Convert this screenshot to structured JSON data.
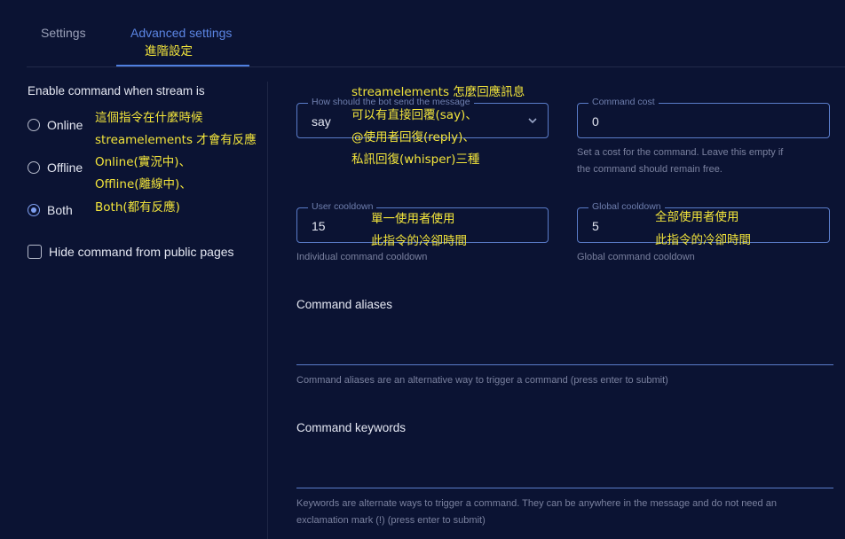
{
  "tabs": [
    {
      "label": "Settings"
    },
    {
      "label": "Advanced settings"
    }
  ],
  "annotations": {
    "tab": "進階設定",
    "radio": [
      "這個指令在什麼時候",
      "streamelements 才會有反應",
      "Online(實況中)、",
      "Offline(離線中)、",
      "Both(都有反應)"
    ],
    "send": [
      "streamelements 怎麼回應訊息",
      "可以有直接回覆(say)、",
      "@使用者回復(reply)、",
      "私訊回復(whisper)三種"
    ],
    "user_cd": [
      "單一使用者使用",
      "此指令的冷卻時間"
    ],
    "global_cd": [
      "全部使用者使用",
      "此指令的冷卻時間"
    ]
  },
  "left": {
    "section_label": "Enable command when stream is",
    "radios": [
      {
        "label": "Online",
        "checked": false
      },
      {
        "label": "Offline",
        "checked": false
      },
      {
        "label": "Both",
        "checked": true
      }
    ],
    "hide_label": "Hide command from public pages"
  },
  "fields": {
    "send": {
      "legend": "How should the bot send the message",
      "value": "say"
    },
    "cost": {
      "legend": "Command cost",
      "value": "0",
      "helper_1": "Set a cost for the command. Leave this empty if",
      "helper_2": "the command should remain free."
    },
    "user_cooldown": {
      "legend": "User cooldown",
      "value": "15",
      "helper": "Individual command cooldown"
    },
    "global_cooldown": {
      "legend": "Global cooldown",
      "value": "5",
      "helper": "Global command cooldown"
    }
  },
  "aliases": {
    "heading": "Command aliases",
    "helper": "Command aliases are an alternative way to trigger a command (press enter to submit)"
  },
  "keywords": {
    "heading": "Command keywords",
    "helper_1": "Keywords are alternate ways to trigger a command. They can be anywhere in the message and do not need an",
    "helper_2": "exclamation mark (!) (press enter to submit)"
  },
  "colors": {
    "background": "#0b1333",
    "accent": "#4f7fe0",
    "annotation": "#f3e53b"
  }
}
